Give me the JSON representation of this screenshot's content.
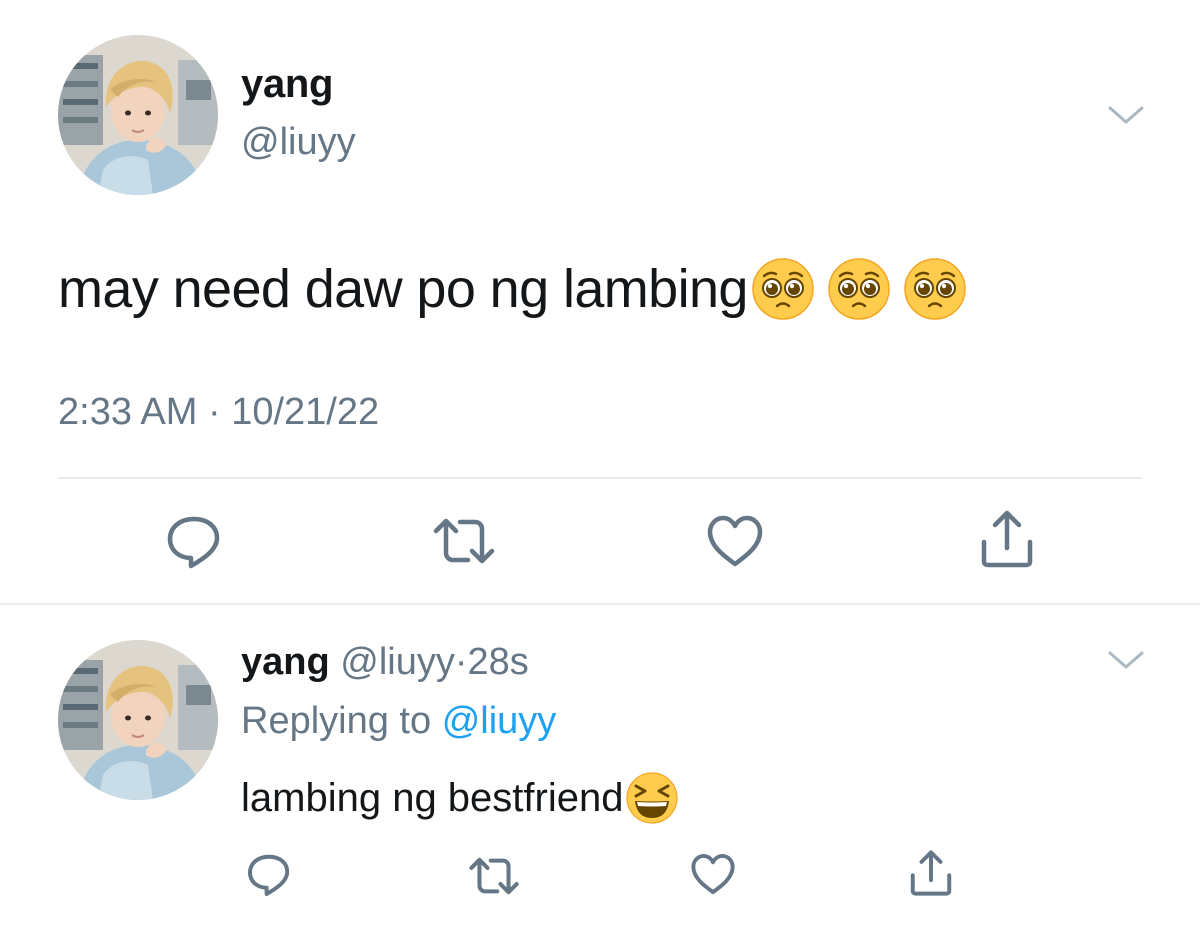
{
  "tweet": {
    "display_name": "yang",
    "handle": "@liuyy",
    "text": "may need daw po ng lambing",
    "emojis": [
      "pleading-face",
      "pleading-face",
      "pleading-face"
    ],
    "timestamp": "2:33 AM · 10/21/22",
    "actions": [
      "reply",
      "retweet",
      "like",
      "share"
    ]
  },
  "reply": {
    "display_name": "yang",
    "handle": "@liuyy",
    "separator": "·",
    "relative_time": "28s",
    "replying_label": "Replying to",
    "replying_target": "@liuyy",
    "text": "lambing ng bestfriend",
    "emoji": "grinning-squinting-face",
    "actions": [
      "reply",
      "retweet",
      "like",
      "share"
    ]
  },
  "colors": {
    "text_primary": "#14171a",
    "text_secondary": "#657786",
    "link": "#1da1f2",
    "icon": "#657786",
    "divider": "#e6ecf0"
  }
}
